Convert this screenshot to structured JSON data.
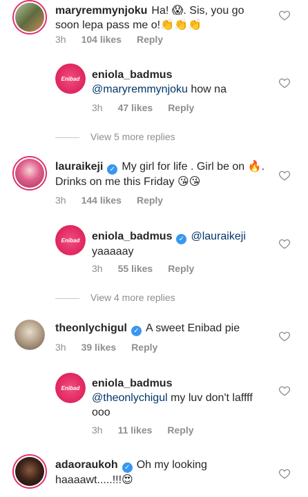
{
  "comments": [
    {
      "username": "maryremmynjoku",
      "text": "Ha! 😱. Sis, you go soon lepa pass me o!👏👏👏",
      "time": "3h",
      "likes": "104 likes",
      "reply": "Reply"
    },
    {
      "username": "eniola_badmus",
      "mention": "@maryremmynjoku",
      "text": " how na",
      "time": "3h",
      "likes": "47 likes",
      "reply": "Reply"
    },
    {
      "username": "lauraikeji",
      "text": "My girl for life . Girl be on 🔥. Drinks on me this Friday 😘😘",
      "time": "3h",
      "likes": "144 likes",
      "reply": "Reply"
    },
    {
      "username": "eniola_badmus",
      "mention": "@lauraikeji",
      "text": "yaaaaay",
      "time": "3h",
      "likes": "55 likes",
      "reply": "Reply"
    },
    {
      "username": "theonlychigul",
      "text": "A sweet Enibad pie",
      "time": "3h",
      "likes": "39 likes",
      "reply": "Reply"
    },
    {
      "username": "eniola_badmus",
      "mention": "@theonlychigul",
      "text": " my luv don't laffff ooo",
      "time": "3h",
      "likes": "11 likes",
      "reply": "Reply"
    },
    {
      "username": "adaoraukoh",
      "text": "Oh my looking haaaawt.....!!!😍",
      "time": "",
      "likes": "",
      "reply": ""
    }
  ],
  "view_more_1": "View 5 more replies",
  "view_more_2": "View 4 more replies",
  "logo_text": "Enibad",
  "icons": {
    "like": "heart-outline-icon",
    "verified": "verified-badge-icon"
  },
  "colors": {
    "mention": "#003569",
    "verified": "#3897f0",
    "meta": "#8e8e8e",
    "brand": "#e0245e"
  }
}
